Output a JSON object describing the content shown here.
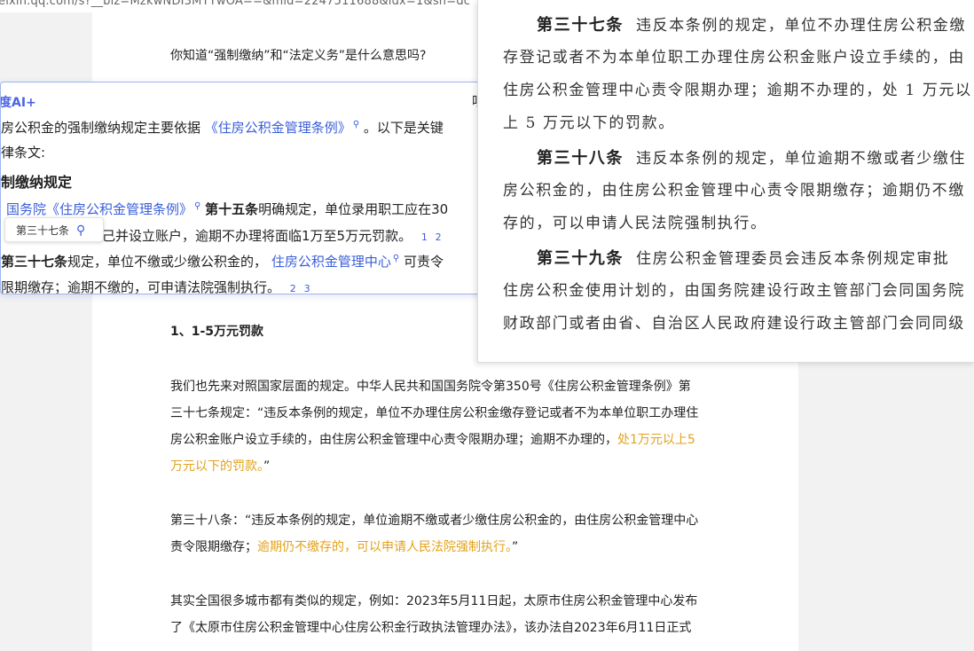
{
  "browser": {
    "url": "eixin.qq.com/s?__biz=MzkwNDI3MTYwOA==&mid=2247511688&idx=1&sn=dc"
  },
  "article": {
    "question": "你知道“强制缴纳”和“法定义务”是什么意思吗?",
    "section_title": "1、1-5万元罚款",
    "para1_a": "我们也先来对照国家层面的规定。中华人民共和国国务院令第350号《住房公积金管理条例》第",
    "para1_b": "三十七条规定：“违反本条例的规定，单位不办理住房公积金缴存登记或者不为本单位职工办理住",
    "para1_c": "房公积金账户设立手续的，由住房公积金管理中心责令限期办理；逾期不办理的，",
    "para1_hl1": "处1万元以上5",
    "para1_hl2": "万元以下的罚款。",
    "para1_end": "”",
    "para2_a": "第三十八条：“违反本条例的规定，单位逾期不缴或者少缴住房公积金的，由住房公积金管理中心",
    "para2_b": "责令限期缴存；",
    "para2_hl": "逾期仍不缴存的，可以申请人民法院强制执行。",
    "para2_end": "”",
    "para3_a": "其实全国很多城市都有类似的规定，例如：2023年5月11日起，太原市住房公积金管理中心发布",
    "para3_b": "了《太原市住房公积金管理中心住房公积金行政执法管理办法》，该办法自2023年6月11日正式"
  },
  "ai_panel": {
    "brand": "度AI+",
    "listen_label": "听",
    "line1_a": "房公积金的强制缴纳规定主要依据",
    "line1_link": "《住房公积金管理条例》",
    "line1_b": "。以下是关键",
    "line2": "律条文:",
    "heading": "制缴纳规定",
    "line4_link": "国务院《住房公积金管理条例》",
    "line4_bold": "第十五条",
    "line4_b": "明确规定，单位录用职工应在30",
    "line5": "己并设立账户，逾期不办理将面临1万至5万元罚款。",
    "line5_cites": [
      "1",
      "2"
    ],
    "line6_bold": "第三十七条",
    "line6_a": "规定，单位不缴或少缴公积金的，",
    "line6_link": "住房公积金管理中心",
    "line6_b": "可责令",
    "line7": "限期缴存；逾期不缴的，可申请法院强制执行。",
    "line7_cites": [
      "2",
      "3"
    ],
    "tooltip_label": "第三十七条"
  },
  "law_doc": {
    "art37_title": "第三十七条",
    "art37_l1": "违反本条例的规定，单位不办理住房公积金缴",
    "art37_l2": "存登记或者不为本单位职工办理住房公积金账户设立手续的，由",
    "art37_l3": "住房公积金管理中心责令限期办理；逾期不办理的，处 1 万元以",
    "art37_l4": "上 5 万元以下的罚款。",
    "art38_title": "第三十八条",
    "art38_l1": "违反本条例的规定，单位逾期不缴或者少缴住",
    "art38_l2": "房公积金的，由住房公积金管理中心责令限期缴存；逾期仍不缴",
    "art38_l3": "存的，可以申请人民法院强制执行。",
    "art39_title": "第三十九条",
    "art39_l1": "住房公积金管理委员会违反本条例规定审批",
    "art39_l2": "住房公积金使用计划的，由国务院建设行政主管部门会同国务院",
    "art39_l3": "财政部门或者由省、自治区人民政府建设行政主管部门会同同级"
  },
  "colors": {
    "highlight": "#e3a21a",
    "link": "#3a5fd9",
    "brand": "#4a64e8"
  },
  "icons": {
    "search": "search-icon"
  }
}
